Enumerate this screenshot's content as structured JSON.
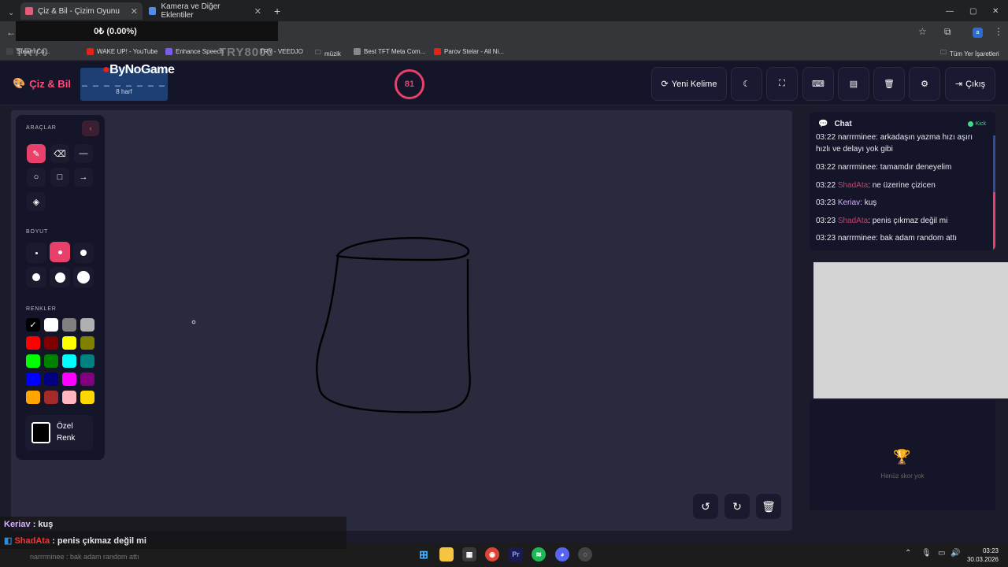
{
  "browser": {
    "tabs": [
      {
        "title": "Çiz & Bil - Çizim Oyunu"
      },
      {
        "title": "Kamera ve Diğer Eklentiler"
      }
    ],
    "tab_overlay": "Kamera ve Diğer Eklentiler",
    "bookmarks": [
      {
        "label": "Steam Co..."
      },
      {
        "label": "WAKE UP! - YouTube"
      },
      {
        "label": "Enhance Speech"
      },
      {
        "label": "TRY - VEEDJO"
      },
      {
        "label": "müzik"
      },
      {
        "label": "Best TFT Meta Com..."
      },
      {
        "label": "Parov Stelar - All Ni..."
      }
    ],
    "all_bookmarks": "Tüm Yer İşaretleri",
    "profile_badge": "a"
  },
  "stream": {
    "donation": "0₺ (0.00%)",
    "watermark_left": "TRY0",
    "watermark_right": "TRY8000"
  },
  "app": {
    "logo": "Çiz & Bil",
    "sponsor": "ByNoGame",
    "word_mask": "_ _ _ _ _ _ _ _",
    "word_length": "8 harf",
    "timer": "81",
    "buttons": {
      "new_word": "Yeni Kelime",
      "exit": "Çıkış"
    }
  },
  "toolbox": {
    "tools_title": "ARAÇLAR",
    "size_title": "BOYUT",
    "colors_title": "RENKLER",
    "custom_color_line1": "Özel",
    "custom_color_line2": "Renk",
    "swatches": [
      "#000000",
      "#ffffff",
      "#808080",
      "#b0b0b0",
      "#ff0000",
      "#800000",
      "#ffff00",
      "#808000",
      "#00ff00",
      "#008000",
      "#00ffff",
      "#008080",
      "#0000ff",
      "#000080",
      "#ff00ff",
      "#800080",
      "#ffa500",
      "#a52a2a",
      "#ffb6c1",
      "#ffd700"
    ]
  },
  "chat": {
    "title": "Chat",
    "status": "Kick",
    "messages": [
      {
        "time": "03:22",
        "user": "narrrminee",
        "text": ": arkadaşın yazma hızı aşırı hızlı ve delayı yok gibi"
      },
      {
        "time": "03:22",
        "user": "narrrminee",
        "text": ": tamamdır deneyelim"
      },
      {
        "time": "03:22",
        "user": "ShadAta",
        "text": ": ne üzerine çizicen"
      },
      {
        "time": "03:23",
        "user": "Keriav",
        "text": ": kuş"
      },
      {
        "time": "03:23",
        "user": "ShadAta",
        "text": ": penis çıkmaz değil mi"
      },
      {
        "time": "03:23",
        "user": "narrrminee",
        "text": ": bak adam random attı"
      }
    ]
  },
  "score": {
    "empty": "Henüz skor yok"
  },
  "overlay_chat": [
    {
      "user": "Keriav",
      "text": " : kuş"
    },
    {
      "user": "ShadAta",
      "text": " : penis çıkmaz değil mi"
    },
    {
      "user": "narrrminee",
      "text": " : bak adam random attı"
    }
  ],
  "taskbar": {
    "time": "03:23",
    "date": "30.03.2026"
  }
}
